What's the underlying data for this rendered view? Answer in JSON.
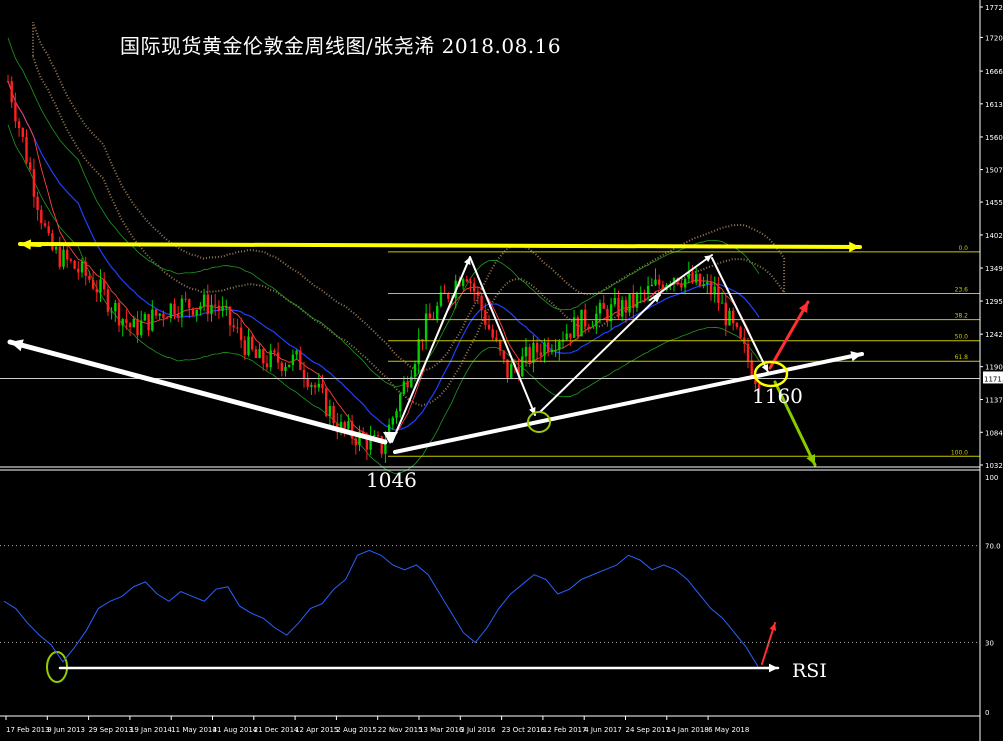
{
  "title": "国际现货黄金伦敦金周线图/张尧浠 2018.08.16",
  "colors": {
    "background": "#000000",
    "bull": "#00d000",
    "bear": "#ff2020",
    "cloud": "#c8a070",
    "rsi_line": "#2a60ff",
    "fib": "#c8c800",
    "trend_yellow": "#ffff00",
    "arrow_white": "#ffffff",
    "arrow_red": "#ff3030",
    "arrow_green": "#88cc00",
    "marker_circle_yellow": "#ffff00",
    "marker_circle_green": "#99cc00"
  },
  "annotations": {
    "low_label": "1046",
    "target_label": "1160",
    "rsi_label": "RSI"
  },
  "chart_data": [
    {
      "type": "candlestick",
      "ylim": [
        1032.0,
        1772.4
      ],
      "y_tick_labels": [
        "1772.4",
        "1720.2",
        "1666.0",
        "1613.3",
        "1560.0",
        "1507.5",
        "1455.2",
        "1402.3",
        "1349.0",
        "1295.9",
        "1242.6",
        "1190.3",
        "1171.3",
        "1137.4",
        "1084.7",
        "1032.0"
      ],
      "highlight_price": "1171.3",
      "x_tick_labels": [
        "17 Feb 2013",
        "9 Jun 2013",
        "29 Sep 2013",
        "19 Jan 2014",
        "11 May 2014",
        "31 Aug 2014",
        "21 Dec 2014",
        "12 Apr 2015",
        "2 Aug 2015",
        "22 Nov 2015",
        "13 Mar 2016",
        "3 Jul 2016",
        "23 Oct 2016",
        "12 Feb 2017",
        "4 Jun 2017",
        "24 Sep 2017",
        "14 Jan 2018",
        "6 May 2018"
      ],
      "fibonacci": [
        {
          "label": "0.0",
          "price": 1375
        },
        {
          "label": "23.6",
          "price": 1308
        },
        {
          "label": "38.2",
          "price": 1266
        },
        {
          "label": "50.0",
          "price": 1232
        },
        {
          "label": "61.8",
          "price": 1199
        },
        {
          "label": "100.0",
          "price": 1046
        }
      ],
      "price_path": [
        {
          "date": "17 Feb 2013",
          "close": 1650
        },
        {
          "date": "9 Jun 2013",
          "close": 1380
        },
        {
          "date": "29 Sep 2013",
          "close": 1330
        },
        {
          "date": "19 Jan 2014",
          "close": 1250
        },
        {
          "date": "11 May 2014",
          "close": 1290
        },
        {
          "date": "31 Aug 2014",
          "close": 1290
        },
        {
          "date": "21 Dec 2014",
          "close": 1200
        },
        {
          "date": "12 Apr 2015",
          "close": 1200
        },
        {
          "date": "2 Aug 2015",
          "close": 1090
        },
        {
          "date": "22 Nov 2015",
          "close": 1060
        },
        {
          "date": "13 Mar 2016",
          "close": 1250
        },
        {
          "date": "3 Jul 2016",
          "close": 1350
        },
        {
          "date": "23 Oct 2016",
          "close": 1180
        },
        {
          "date": "12 Feb 2017",
          "close": 1230
        },
        {
          "date": "4 Jun 2017",
          "close": 1270
        },
        {
          "date": "24 Sep 2017",
          "close": 1290
        },
        {
          "date": "14 Jan 2018",
          "close": 1340
        },
        {
          "date": "6 May 2018",
          "close": 1310
        },
        {
          "date": "Aug 2018",
          "close": 1175
        }
      ]
    },
    {
      "type": "line",
      "name": "RSI",
      "ylim": [
        0,
        100
      ],
      "y_tick_labels": [
        "100",
        "70.0",
        "30",
        "0"
      ],
      "levels": [
        70,
        30
      ],
      "values": [
        47,
        44,
        38,
        33,
        29,
        22,
        28,
        35,
        44,
        47,
        49,
        53,
        55,
        50,
        47,
        51,
        49,
        47,
        52,
        53,
        45,
        42,
        40,
        36,
        33,
        38,
        44,
        46,
        52,
        56,
        66,
        68,
        66,
        62,
        60,
        62,
        58,
        50,
        42,
        34,
        30,
        36,
        44,
        50,
        54,
        58,
        56,
        50,
        52,
        56,
        58,
        60,
        62,
        66,
        64,
        60,
        62,
        60,
        56,
        50,
        44,
        40,
        34,
        28,
        20
      ]
    }
  ]
}
